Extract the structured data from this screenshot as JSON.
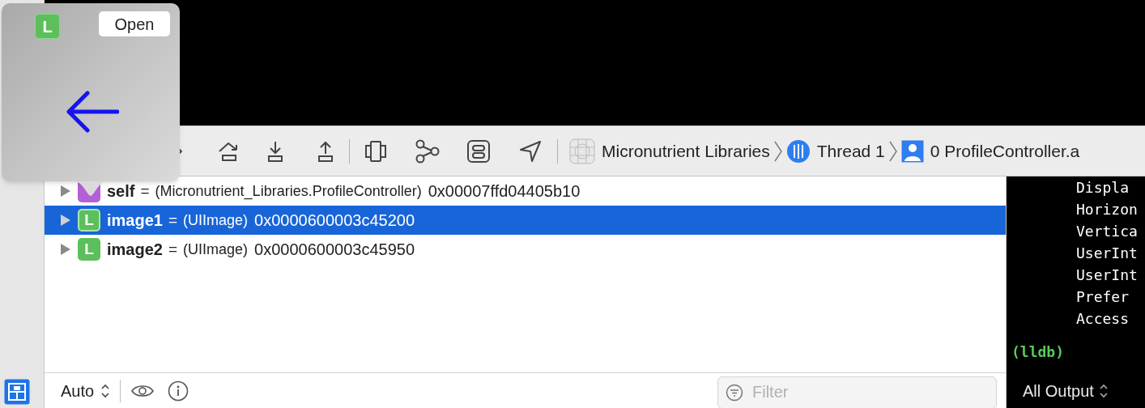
{
  "popover": {
    "badge": "L",
    "open_button": "Open"
  },
  "toolbar": {
    "breadcrumbs": [
      {
        "label": "Micronutrient Libraries",
        "kind": "app"
      },
      {
        "label": "Thread 1",
        "kind": "thread"
      },
      {
        "label": "0 ProfileController.a",
        "kind": "frame"
      }
    ]
  },
  "variables": [
    {
      "kind": "instance",
      "name": "self",
      "operator": "=",
      "type": "(Micronutrient_Libraries.ProfileController)",
      "address": "0x00007ffd04405b10",
      "selected": false,
      "expanded": false
    },
    {
      "kind": "local",
      "badge": "L",
      "name": "image1",
      "operator": "=",
      "type": "(UIImage)",
      "address": "0x0000600003c45200",
      "selected": true,
      "expanded": false
    },
    {
      "kind": "local",
      "badge": "L",
      "name": "image2",
      "operator": "=",
      "type": "(UIImage)",
      "address": "0x0000600003c45950",
      "selected": false,
      "expanded": false
    }
  ],
  "bottom_bar": {
    "scope": "Auto",
    "filter_placeholder": "Filter"
  },
  "console": {
    "lines": [
      "Displa",
      "Horizon",
      "Vertica",
      "UserInt",
      "UserInt",
      "Prefer",
      "Access"
    ],
    "prompt": "(lldb)",
    "output_selector": "All Output"
  }
}
